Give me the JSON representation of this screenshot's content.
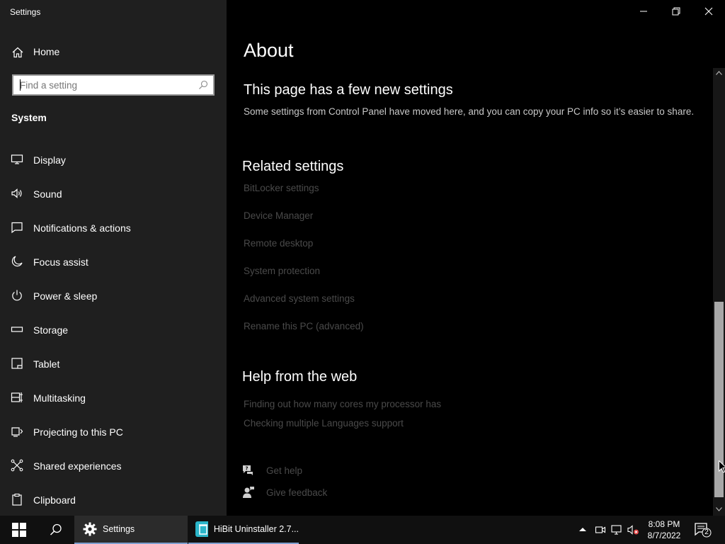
{
  "window": {
    "title": "Settings"
  },
  "sidebar": {
    "home_label": "Home",
    "search_placeholder": "Find a setting",
    "section_label": "System",
    "items": [
      {
        "label": "Display",
        "icon": "monitor-icon"
      },
      {
        "label": "Sound",
        "icon": "speaker-icon"
      },
      {
        "label": "Notifications & actions",
        "icon": "notification-icon"
      },
      {
        "label": "Focus assist",
        "icon": "moon-icon"
      },
      {
        "label": "Power & sleep",
        "icon": "power-icon"
      },
      {
        "label": "Storage",
        "icon": "storage-icon"
      },
      {
        "label": "Tablet",
        "icon": "tablet-icon"
      },
      {
        "label": "Multitasking",
        "icon": "multitasking-icon"
      },
      {
        "label": "Projecting to this PC",
        "icon": "projecting-icon"
      },
      {
        "label": "Shared experiences",
        "icon": "shared-icon"
      },
      {
        "label": "Clipboard",
        "icon": "clipboard-icon"
      }
    ]
  },
  "main": {
    "title": "About",
    "new_settings": {
      "heading": "This page has a few new settings",
      "description": "Some settings from Control Panel have moved here, and you can copy your PC info so it’s easier to share."
    },
    "related": {
      "heading": "Related settings",
      "links": [
        "BitLocker settings",
        "Device Manager",
        "Remote desktop",
        "System protection",
        "Advanced system settings",
        "Rename this PC (advanced)"
      ]
    },
    "help": {
      "heading": "Help from the web",
      "links": [
        "Finding out how many cores my processor has",
        "Checking multiple Languages support"
      ]
    },
    "get_help": "Get help",
    "give_feedback": "Give feedback"
  },
  "taskbar": {
    "settings_label": "Settings",
    "hibit_label": "HiBit Uninstaller 2.7...",
    "time": "8:08 PM",
    "date": "8/7/2022",
    "notification_count": "2"
  },
  "colors": {
    "accent": "#7f9fcf",
    "sidebar_bg": "#1f1f1f",
    "link_dim": "#4a4a4a"
  }
}
